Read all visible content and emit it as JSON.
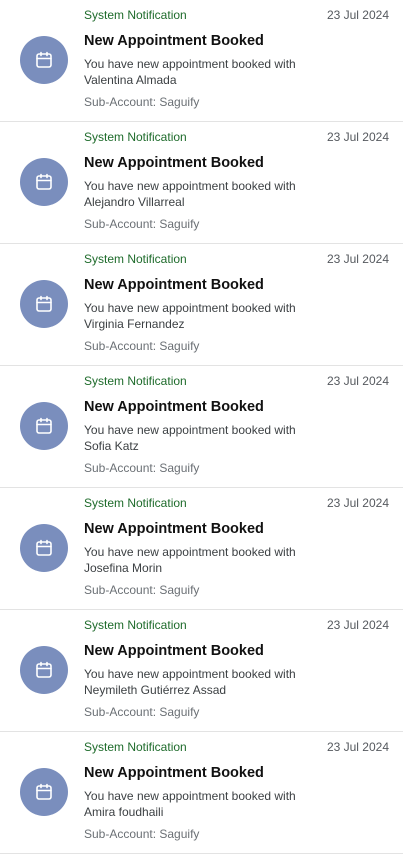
{
  "colors": {
    "avatar_bg": "#7a8ebd",
    "source_text": "#1e6b2b",
    "divider": "#e3e3e3"
  },
  "notifications": [
    {
      "icon": "calendar-icon",
      "source": "System Notification",
      "date": "23 Jul 2024",
      "title": "New Appointment Booked",
      "body_prefix": "You have new appointment booked with",
      "name": "Valentina Almada",
      "sub_account": "Sub-Account: Saguify"
    },
    {
      "icon": "calendar-icon",
      "source": "System Notification",
      "date": "23 Jul 2024",
      "title": "New Appointment Booked",
      "body_prefix": "You have new appointment booked with",
      "name": "Alejandro Villarreal",
      "sub_account": "Sub-Account: Saguify"
    },
    {
      "icon": "calendar-icon",
      "source": "System Notification",
      "date": "23 Jul 2024",
      "title": "New Appointment Booked",
      "body_prefix": "You have new appointment booked with",
      "name": "Virginia Fernandez",
      "sub_account": "Sub-Account: Saguify"
    },
    {
      "icon": "calendar-icon",
      "source": "System Notification",
      "date": "23 Jul 2024",
      "title": "New Appointment Booked",
      "body_prefix": "You have new appointment booked with",
      "name": "Sofia Katz",
      "sub_account": "Sub-Account: Saguify"
    },
    {
      "icon": "calendar-icon",
      "source": "System Notification",
      "date": "23 Jul 2024",
      "title": "New Appointment Booked",
      "body_prefix": "You have new appointment booked with",
      "name": "Josefina Morin",
      "sub_account": "Sub-Account: Saguify"
    },
    {
      "icon": "calendar-icon",
      "source": "System Notification",
      "date": "23 Jul 2024",
      "title": "New Appointment Booked",
      "body_prefix": "You have new appointment booked with",
      "name": "Neymileth Gutiérrez Assad",
      "sub_account": "Sub-Account: Saguify"
    },
    {
      "icon": "calendar-icon",
      "source": "System Notification",
      "date": "23 Jul 2024",
      "title": "New Appointment Booked",
      "body_prefix": "You have new appointment booked with",
      "name": "Amira foudhaili",
      "sub_account": "Sub-Account: Saguify"
    }
  ]
}
